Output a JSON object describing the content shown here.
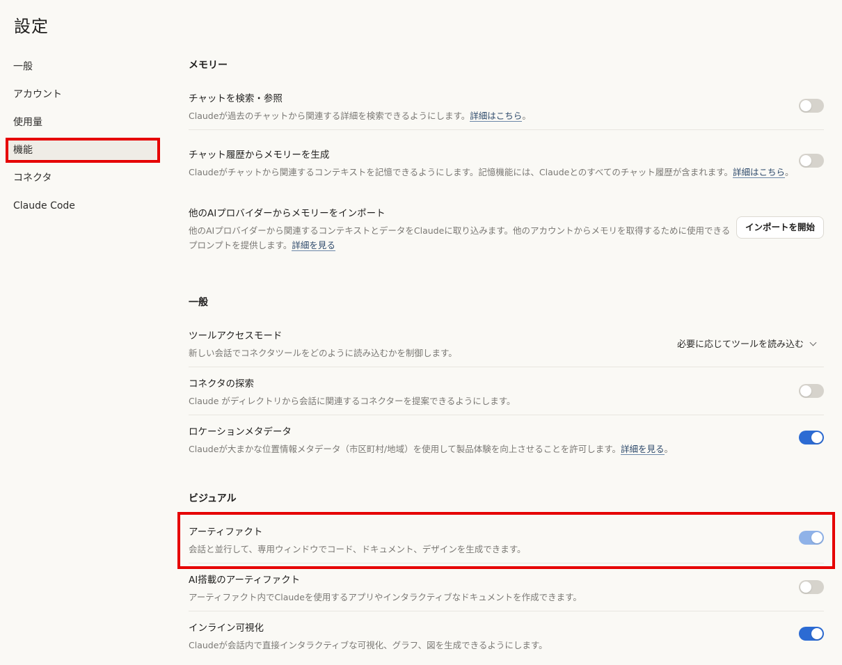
{
  "page": {
    "title": "設定"
  },
  "sidebar": {
    "items": [
      {
        "label": "一般"
      },
      {
        "label": "アカウント"
      },
      {
        "label": "使用量"
      },
      {
        "label": "機能"
      },
      {
        "label": "コネクタ"
      },
      {
        "label": "Claude Code"
      }
    ]
  },
  "memory": {
    "title": "メモリー",
    "search": {
      "title": "チャットを検索・参照",
      "desc": "Claudeが過去のチャットから関連する詳細を検索できるようにします。",
      "link": "詳細はこちら",
      "suffix": "。",
      "enabled": false
    },
    "generate": {
      "title": "チャット履歴からメモリーを生成",
      "desc": "Claudeがチャットから関連するコンテキストを記憶できるようにします。記憶機能には、Claudeとのすべてのチャット履歴が含まれます。",
      "link": "詳細はこちら",
      "suffix": "。",
      "enabled": false
    },
    "import": {
      "title": "他のAIプロバイダーからメモリーをインポート",
      "desc": "他のAIプロバイダーから関連するコンテキストとデータをClaudeに取り込みます。他のアカウントからメモリを取得するために使用できるプロンプトを提供します。",
      "link": "詳細を見る",
      "button": "インポートを開始"
    }
  },
  "general": {
    "title": "一般",
    "tool_access": {
      "title": "ツールアクセスモード",
      "desc": "新しい会話でコネクタツールをどのように読み込むかを制御します。",
      "selected": "必要に応じてツールを読み込む"
    },
    "connector_discovery": {
      "title": "コネクタの探索",
      "desc": "Claude がディレクトリから会話に関連するコネクターを提案できるようにします。",
      "enabled": false
    },
    "location": {
      "title": "ロケーションメタデータ",
      "desc": "Claudeが大まかな位置情報メタデータ（市区町村/地域）を使用して製品体験を向上させることを許可します。",
      "link": "詳細を見る",
      "suffix": "。",
      "enabled": true
    }
  },
  "visual": {
    "title": "ビジュアル",
    "artifacts": {
      "title": "アーティファクト",
      "desc": "会話と並行して、専用ウィンドウでコード、ドキュメント、デザインを生成できます。",
      "enabled": true
    },
    "ai_artifacts": {
      "title": "AI搭載のアーティファクト",
      "desc": "アーティファクト内でClaudeを使用するアプリやインタラクティブなドキュメントを作成できます。",
      "enabled": false
    },
    "inline_viz": {
      "title": "インライン可視化",
      "desc": "Claudeが会話内で直接インタラクティブな可視化、グラフ、図を生成できるようにします。",
      "enabled": true
    }
  },
  "colors": {
    "accent": "#2c6bd3",
    "highlight": "#e60000",
    "background": "#faf9f5"
  }
}
